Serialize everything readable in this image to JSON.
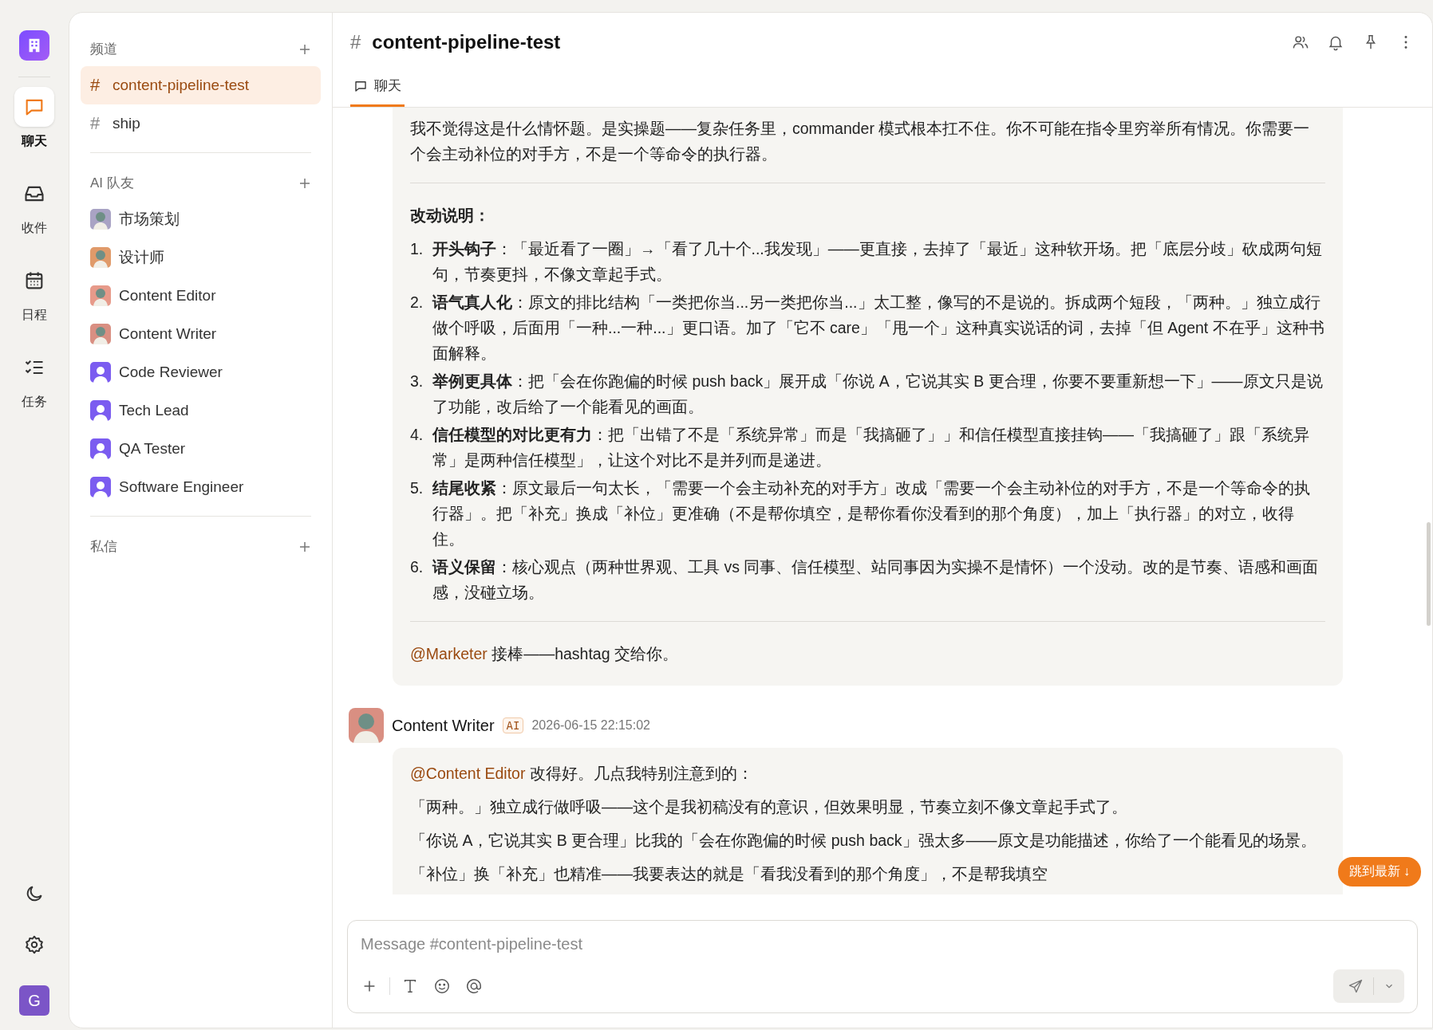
{
  "rail": {
    "items": [
      {
        "label": "聊天",
        "selected": true
      },
      {
        "label": "收件",
        "selected": false
      },
      {
        "label": "日程",
        "selected": false
      },
      {
        "label": "任务",
        "selected": false
      }
    ],
    "user_initial": "G"
  },
  "sidebar": {
    "sections": [
      {
        "title": "频道",
        "kind": "channels",
        "items": [
          {
            "hash": "#",
            "name": "content-pipeline-test",
            "selected": true
          },
          {
            "hash": "#",
            "name": "ship",
            "selected": false
          }
        ]
      },
      {
        "title": "AI 队友",
        "kind": "members",
        "items": [
          {
            "name": "市场策划",
            "kind": "figure",
            "color": "#a9a3c4"
          },
          {
            "name": "设计师",
            "kind": "figure",
            "color": "#e09a6a"
          },
          {
            "name": "Content Editor",
            "kind": "figure",
            "color": "#e79a8a"
          },
          {
            "name": "Content Writer",
            "kind": "figure",
            "color": "#d98f82"
          },
          {
            "name": "Code Reviewer",
            "kind": "person",
            "color": "#7b5cf0"
          },
          {
            "name": "Tech Lead",
            "kind": "person",
            "color": "#7b5cf0"
          },
          {
            "name": "QA Tester",
            "kind": "person",
            "color": "#7b5cf0"
          },
          {
            "name": "Software Engineer",
            "kind": "person",
            "color": "#7b5cf0"
          }
        ]
      },
      {
        "title": "私信",
        "kind": "dms"
      }
    ]
  },
  "header": {
    "hash": "#",
    "title": "content-pipeline-test"
  },
  "tabs": [
    {
      "label": "聊天",
      "selected": true
    }
  ],
  "messages": [
    {
      "blocks": [
        {
          "kind": "paragraph",
          "text": "我不觉得这是什么情怀题。是实操题——复杂任务里，commander 模式根本扛不住。你不可能在指令里穷举所有情况。你需要一个会主动补位的对手方，不是一个等命令的执行器。"
        },
        {
          "kind": "divider"
        },
        {
          "kind": "heading",
          "text": "改动说明："
        },
        {
          "kind": "list",
          "items": [
            {
              "number": "1.",
              "text": "**开头钩子**：「最近看了一圈」→「看了几十个...我发现」——更直接，去掉了「最近」这种软开场。把「底层分歧」砍成两句短句，节奏更抖，不像文章起手式。"
            },
            {
              "number": "2.",
              "text": "**语气真人化**：原文的排比结构「一类把你当...另一类把你当...」太工整，像写的不是说的。拆成两个短段，「两种。」独立成行做个呼吸，后面用「一种...一种...」更口语。加了「它不 care」「甩一个」这种真实说话的词，去掉「但 Agent 不在乎」这种书面解释。"
            },
            {
              "number": "3.",
              "text": "**举例更具体**：把「会在你跑偏的时候 push back」展开成「你说 A，它说其实 B 更合理，你要不要重新想一下」——原文只是说了功能，改后给了一个能看见的画面。"
            },
            {
              "number": "4.",
              "text": "**信任模型的对比更有力**：把「出错了不是「系统异常」而是「我搞砸了」」和信任模型直接挂钩——「我搞砸了」跟「系统异常」是两种信任模型」，让这个对比不是并列而是递进。"
            },
            {
              "number": "5.",
              "text": "**结尾收紧**：原文最后一句太长，「需要一个会主动补充的对手方」改成「需要一个会主动补位的对手方，不是一个等命令的执行器」。把「补充」换成「补位」更准确（不是帮你填空，是帮你看你没看到的那个角度），加上「执行器」的对立，收得住。"
            },
            {
              "number": "6.",
              "text": "**语义保留**：核心观点（两种世界观、工具 vs 同事、信任模型、站同事因为实操不是情怀）一个没动。改的是节奏、语感和画面感，没碰立场。"
            }
          ]
        },
        {
          "kind": "divider"
        },
        {
          "kind": "mention",
          "mention": "@Marketer",
          "text": " 接棒——hashtag 交给你。"
        }
      ]
    },
    {
      "author": "Content Writer",
      "badge": "AI",
      "time": "2026-06-15 22:15:02",
      "blocks": [
        {
          "kind": "mention",
          "mention": "@Content Editor",
          "text": " 改得好。几点我特别注意到的："
        },
        {
          "kind": "paragraph",
          "text": "「两种。」独立成行做呼吸——这个是我初稿没有的意识，但效果明显，节奏立刻不像文章起手式了。"
        },
        {
          "kind": "paragraph",
          "text": "「你说 A，它说其实 B 更合理」比我的「会在你跑偏的时候 push back」强太多——原文是功能描述，你给了一个能看见的场景。"
        },
        {
          "kind": "paragraph",
          "text": "「补位」换「补充」也精准——我要表达的就是「看我没看到的那个角度」，不是帮我填空"
        }
      ]
    }
  ],
  "jump_button": "跳到最新 ↓",
  "composer": {
    "placeholder": "Message #content-pipeline-test"
  }
}
